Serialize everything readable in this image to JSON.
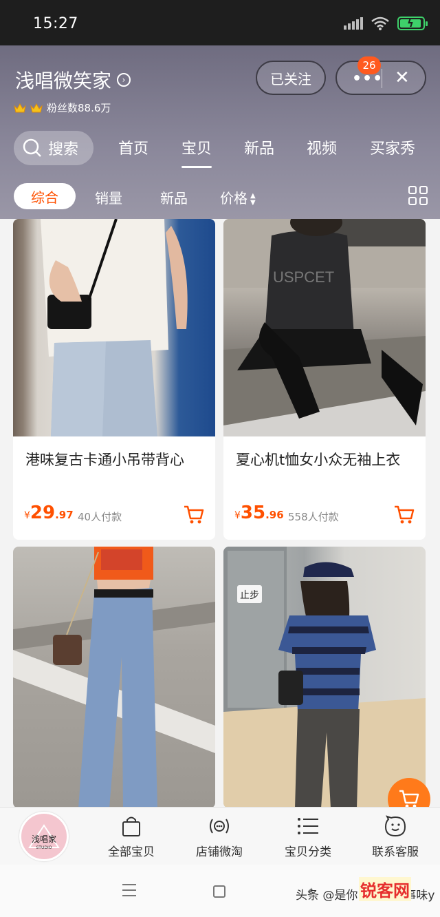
{
  "status_bar": {
    "time": "15:27"
  },
  "store": {
    "name": "浅唱微笑家",
    "fans": "粉丝数88.6万",
    "follow_label": "已关注",
    "more_dots": "•••",
    "badge_count": "26",
    "close_glyph": "✕"
  },
  "nav": {
    "search_label": "搜索",
    "tabs": [
      {
        "label": "首页"
      },
      {
        "label": "宝贝"
      },
      {
        "label": "新品"
      },
      {
        "label": "视频"
      },
      {
        "label": "买家秀"
      }
    ],
    "active_tab": "宝贝"
  },
  "filters": {
    "items": [
      {
        "label": "综合"
      },
      {
        "label": "销量"
      },
      {
        "label": "新品"
      },
      {
        "label": "价格"
      }
    ],
    "active": "综合"
  },
  "products": [
    {
      "title": "港味复古卡通小吊带背心",
      "currency": "¥",
      "price_int": "29",
      "price_dec": ".97",
      "sold": "40人付款"
    },
    {
      "title": "夏心机t恤女小众无袖上衣",
      "currency": "¥",
      "price_int": "35",
      "price_dec": ".96",
      "sold": "558人付款"
    },
    {
      "title": "",
      "currency": "",
      "price_int": "",
      "price_dec": "",
      "sold": ""
    },
    {
      "title": "",
      "currency": "",
      "price_int": "",
      "price_dec": "",
      "sold": ""
    }
  ],
  "photo_signs": {
    "stop_sign": "止步",
    "shirt_text": "USPCET"
  },
  "store_nav": {
    "logo_text": "浅唱家",
    "logo_sub": "STUDIO",
    "items": [
      {
        "label": "全部宝贝",
        "icon": "shopping-bag-icon"
      },
      {
        "label": "店铺微淘",
        "icon": "broadcast-icon"
      },
      {
        "label": "宝贝分类",
        "icon": "category-list-icon"
      },
      {
        "label": "联系客服",
        "icon": "customer-service-icon"
      }
    ]
  },
  "watermark": {
    "text": "头条 @是你曾以前的事味y",
    "logo": "锐客网"
  },
  "colors": {
    "accent": "#ff5000",
    "header_bg": "#807d90",
    "badge": "#ff5a1f"
  }
}
